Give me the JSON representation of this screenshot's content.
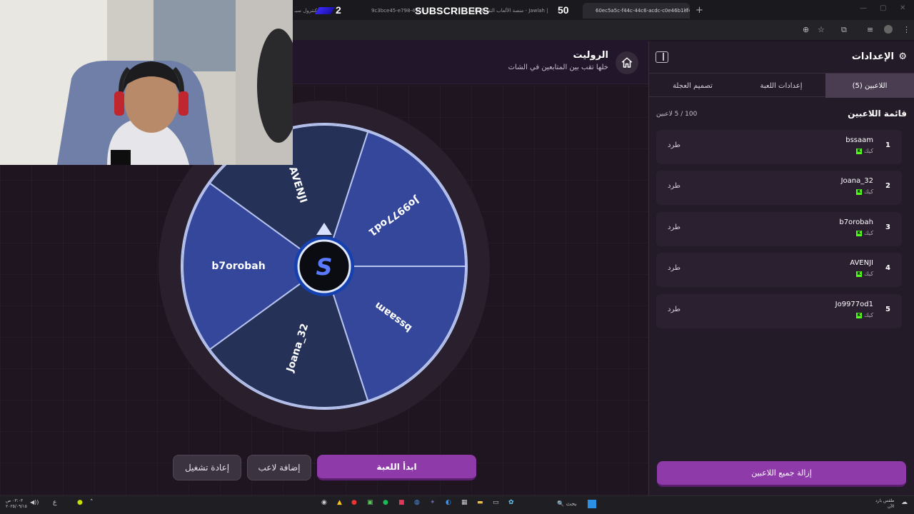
{
  "browser": {
    "tabs": [
      {
        "title": "لا كنترول سبـ",
        "active": false
      },
      {
        "title": "9c3bce45-e798-49c4-...",
        "active": false
      },
      {
        "title": "منصة الألعاب التفاعلية للـ - Jawlah |",
        "active": false
      },
      {
        "title": "60ec5a5c-f44c-44c6-acdc-c0e46b1ef4b0",
        "active": true
      }
    ],
    "new_tab_icon": "plus-icon"
  },
  "overlay": {
    "count_left": "2",
    "label": "SUBSCRIBERS",
    "count_right": "50"
  },
  "header": {
    "title": "الروليت",
    "subtitle": "خلها تقب بين المتابعين في الشات",
    "home_icon": "home-icon"
  },
  "wheel": {
    "segments": [
      "Jo9977od1",
      "bssaam",
      "Joana_32",
      "b7orobah",
      "AVENJI"
    ],
    "colors": [
      "#34479a",
      "#263158"
    ],
    "rim_color": "#2a1f2c",
    "center_logo": "S"
  },
  "controls": {
    "start": "ابدأ اللعبة",
    "add_player": "إضافة لاعب",
    "restart": "إعادة تشغيل"
  },
  "panel": {
    "title": "الإعدادات",
    "gear_icon": "gear-icon",
    "tabs": [
      "اللاعبين (5)",
      "إعدادات اللعبة",
      "تصميم العجلة"
    ],
    "list_title": "قائمة اللاعبين",
    "count": "100 / 5 لاعبين",
    "players": [
      {
        "num": "1",
        "name": "bssaam",
        "platform": "كيك",
        "kick_label": "طرد"
      },
      {
        "num": "2",
        "name": "Joana_32",
        "platform": "كيك",
        "kick_label": "طرد"
      },
      {
        "num": "3",
        "name": "b7orobah",
        "platform": "كيك",
        "kick_label": "طرد"
      },
      {
        "num": "4",
        "name": "AVENJI",
        "platform": "كيك",
        "kick_label": "طرد"
      },
      {
        "num": "5",
        "name": "Jo9977od1",
        "platform": "كيك",
        "kick_label": "طرد"
      }
    ],
    "remove_all": "إزالة جميع اللاعبين"
  },
  "taskbar": {
    "search": "بحث",
    "weather": "طقس بارد",
    "weather_sub": "الآن",
    "time": "٠٣:٠٣ ص",
    "date": "٢٠٢٥/٠٩/١٥"
  }
}
